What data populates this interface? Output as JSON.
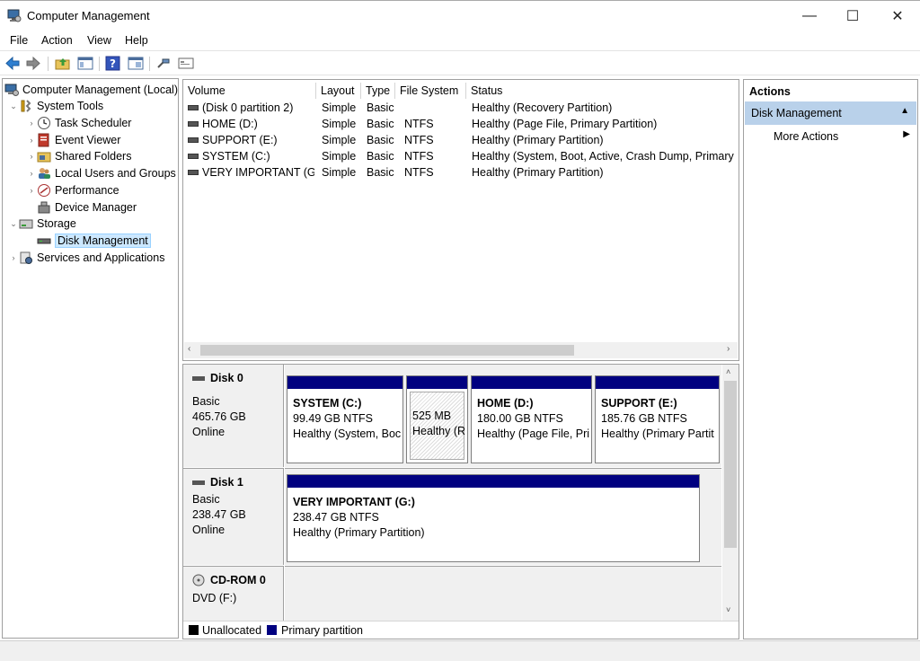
{
  "window": {
    "title": "Computer Management",
    "min": "—",
    "max": "☐",
    "close": "✕"
  },
  "menu": [
    "File",
    "Action",
    "View",
    "Help"
  ],
  "tree": {
    "root": "Computer Management (Local)",
    "system_tools": "System Tools",
    "task_scheduler": "Task Scheduler",
    "event_viewer": "Event Viewer",
    "shared_folders": "Shared Folders",
    "local_users": "Local Users and Groups",
    "performance": "Performance",
    "device_manager": "Device Manager",
    "storage": "Storage",
    "disk_management": "Disk Management",
    "services": "Services and Applications"
  },
  "volumes": {
    "columns": [
      "Volume",
      "Layout",
      "Type",
      "File System",
      "Status"
    ],
    "rows": [
      [
        "(Disk 0 partition 2)",
        "Simple",
        "Basic",
        "",
        "Healthy (Recovery Partition)"
      ],
      [
        "HOME (D:)",
        "Simple",
        "Basic",
        "NTFS",
        "Healthy (Page File, Primary Partition)"
      ],
      [
        "SUPPORT (E:)",
        "Simple",
        "Basic",
        "NTFS",
        "Healthy (Primary Partition)"
      ],
      [
        "SYSTEM (C:)",
        "Simple",
        "Basic",
        "NTFS",
        "Healthy (System, Boot, Active, Crash Dump, Primary P"
      ],
      [
        "VERY IMPORTANT (G:)",
        "Simple",
        "Basic",
        "NTFS",
        "Healthy (Primary Partition)"
      ]
    ]
  },
  "disks": {
    "disk0": {
      "name": "Disk 0",
      "type": "Basic",
      "size": "465.76 GB",
      "state": "Online",
      "p_system": {
        "name": "SYSTEM  (C:)",
        "size": "99.49 GB NTFS",
        "status": "Healthy (System, Boc"
      },
      "p_recovery": {
        "size": "525 MB",
        "status": "Healthy (R"
      },
      "p_home": {
        "name": "HOME  (D:)",
        "size": "180.00 GB NTFS",
        "status": "Healthy (Page File, Pri"
      },
      "p_support": {
        "name": "SUPPORT  (E:)",
        "size": "185.76 GB NTFS",
        "status": "Healthy (Primary Partit"
      }
    },
    "disk1": {
      "name": "Disk 1",
      "type": "Basic",
      "size": "238.47 GB",
      "state": "Online",
      "p_important": {
        "name": "VERY IMPORTANT  (G:)",
        "size": "238.47 GB NTFS",
        "status": "Healthy (Primary Partition)"
      }
    },
    "cdrom0": {
      "name": "CD-ROM 0",
      "type": "DVD (F:)"
    }
  },
  "legend": {
    "unallocated": "Unallocated",
    "primary": "Primary partition",
    "unallocated_color": "#000000",
    "primary_color": "#000080"
  },
  "actions": {
    "header": "Actions",
    "section": "Disk Management",
    "more": "More Actions"
  }
}
